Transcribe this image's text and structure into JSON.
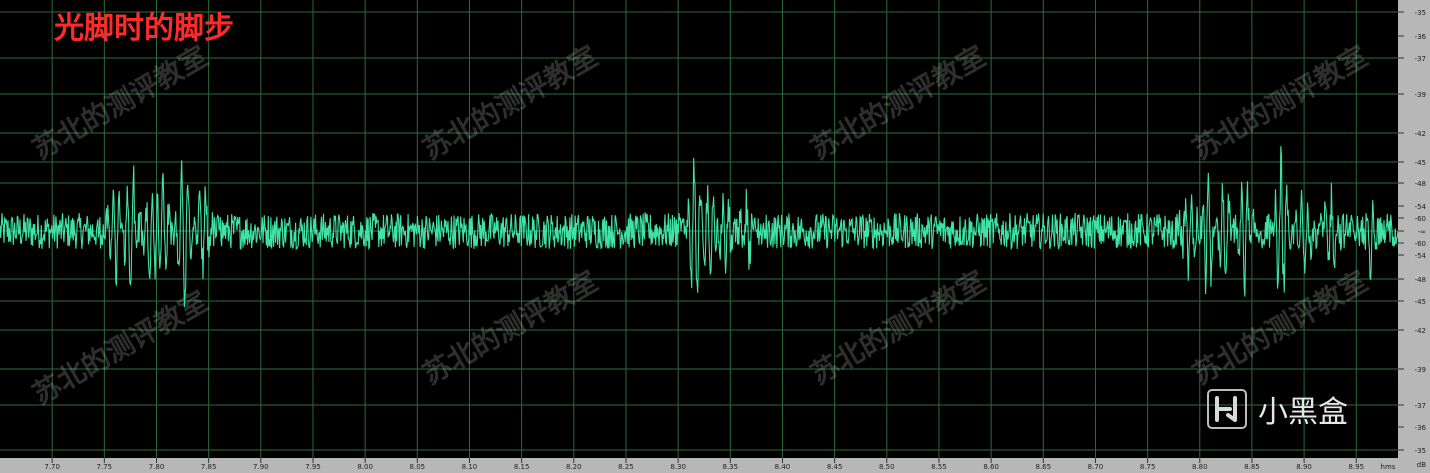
{
  "overlay": {
    "title": "光脚时的脚步",
    "title_color": "#ff2a2a",
    "watermark_text": "苏北的测评教室",
    "logo_text": "小黑盒",
    "logo_icon": "heybox-logo-icon"
  },
  "chart_data": {
    "type": "line",
    "title": "光脚时的脚步",
    "xlabel": "",
    "ylabel": "",
    "x_unit": "hms",
    "y_unit": "dB",
    "xlim": [
      7.65,
      8.99
    ],
    "x_ticks": [
      "7.70",
      "7.75",
      "7.80",
      "7.85",
      "7.90",
      "7.95",
      "8.00",
      "8.05",
      "8.10",
      "8.15",
      "8.20",
      "8.25",
      "8.30",
      "8.35",
      "8.40",
      "8.45",
      "8.50",
      "8.55",
      "8.60",
      "8.65",
      "8.70",
      "8.75",
      "8.80",
      "8.85",
      "8.90",
      "8.95"
    ],
    "y_ticks": [
      "-35",
      "-36",
      "-37",
      "-39",
      "-42",
      "-45",
      "-48",
      "-54",
      "-60",
      "-∞",
      "-60",
      "-54",
      "-48",
      "-45",
      "-42",
      "-39",
      "-37",
      "-36",
      "-35"
    ],
    "ylim": [
      -1,
      1
    ],
    "grid": true,
    "colors": {
      "waveform": "#3fe3a5",
      "grid": "#2c6b3c",
      "background": "#000000",
      "axis_panel": "#b7b7b7"
    },
    "series": [
      {
        "name": "",
        "noise_amplitude": 0.08,
        "transients": [
          {
            "x": 7.76,
            "amplitude": 0.25
          },
          {
            "x": 7.775,
            "amplitude": 0.33
          },
          {
            "x": 7.795,
            "amplitude": 0.22
          },
          {
            "x": 7.806,
            "amplitude": 0.27
          },
          {
            "x": 7.826,
            "amplitude": 0.42
          },
          {
            "x": 7.845,
            "amplitude": 0.22
          },
          {
            "x": 8.316,
            "amplitude": 0.36
          },
          {
            "x": 8.33,
            "amplitude": 0.3
          },
          {
            "x": 8.346,
            "amplitude": 0.22
          },
          {
            "x": 8.365,
            "amplitude": 0.17
          },
          {
            "x": 8.79,
            "amplitude": 0.25
          },
          {
            "x": 8.808,
            "amplitude": 0.31
          },
          {
            "x": 8.823,
            "amplitude": 0.22
          },
          {
            "x": 8.843,
            "amplitude": 0.25
          },
          {
            "x": 8.878,
            "amplitude": 0.37
          },
          {
            "x": 8.9,
            "amplitude": 0.2
          },
          {
            "x": 8.925,
            "amplitude": 0.17
          },
          {
            "x": 8.963,
            "amplitude": 0.16
          }
        ]
      }
    ]
  }
}
